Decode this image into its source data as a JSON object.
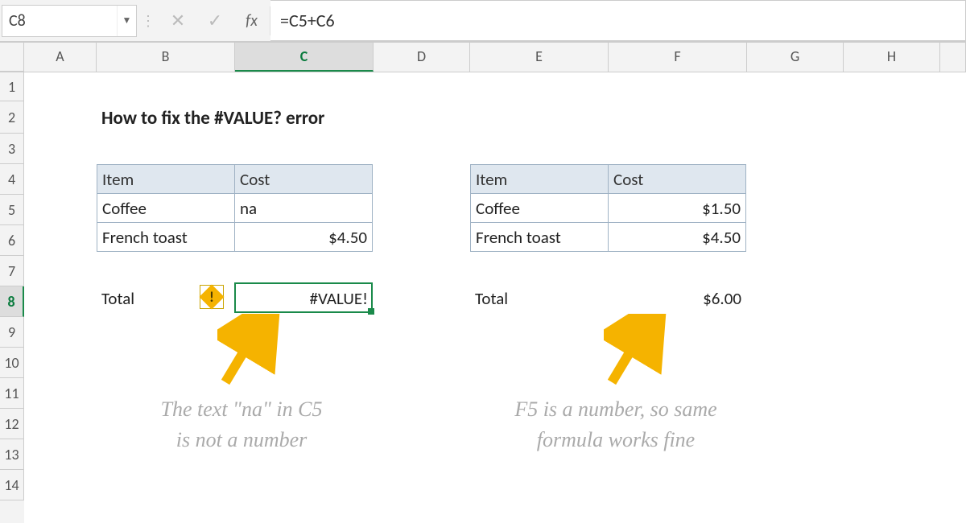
{
  "formula_bar": {
    "cell_ref": "C8",
    "formula": "=C5+C6"
  },
  "columns": [
    "A",
    "B",
    "C",
    "D",
    "E",
    "F",
    "G",
    "H"
  ],
  "rows": [
    "1",
    "2",
    "3",
    "4",
    "5",
    "6",
    "7",
    "8",
    "9",
    "10",
    "11",
    "12",
    "13",
    "14"
  ],
  "selected": {
    "col": "C",
    "row": "8"
  },
  "title": "How to fix the #VALUE? error",
  "table_left": {
    "headers": {
      "item": "Item",
      "cost": "Cost"
    },
    "rows": [
      {
        "item": "Coffee",
        "cost": "na"
      },
      {
        "item": "French toast",
        "cost": "$4.50"
      }
    ],
    "total_label": "Total",
    "total_value": "#VALUE!"
  },
  "table_right": {
    "headers": {
      "item": "Item",
      "cost": "Cost"
    },
    "rows": [
      {
        "item": "Coffee",
        "cost": "$1.50"
      },
      {
        "item": "French toast",
        "cost": "$4.50"
      }
    ],
    "total_label": "Total",
    "total_value": "$6.00"
  },
  "captions": {
    "left": "The text \"na\" in C5\nis not a number",
    "right": "F5 is a number, so same\nformula works fine"
  },
  "icons": {
    "cancel": "✕",
    "accept": "✓",
    "fx": "fx",
    "dropdown": "▼",
    "error_bang": "!"
  },
  "colors": {
    "selection": "#1a8a4a",
    "table_header_bg": "#dfe7ef",
    "arrow": "#f5b300"
  }
}
